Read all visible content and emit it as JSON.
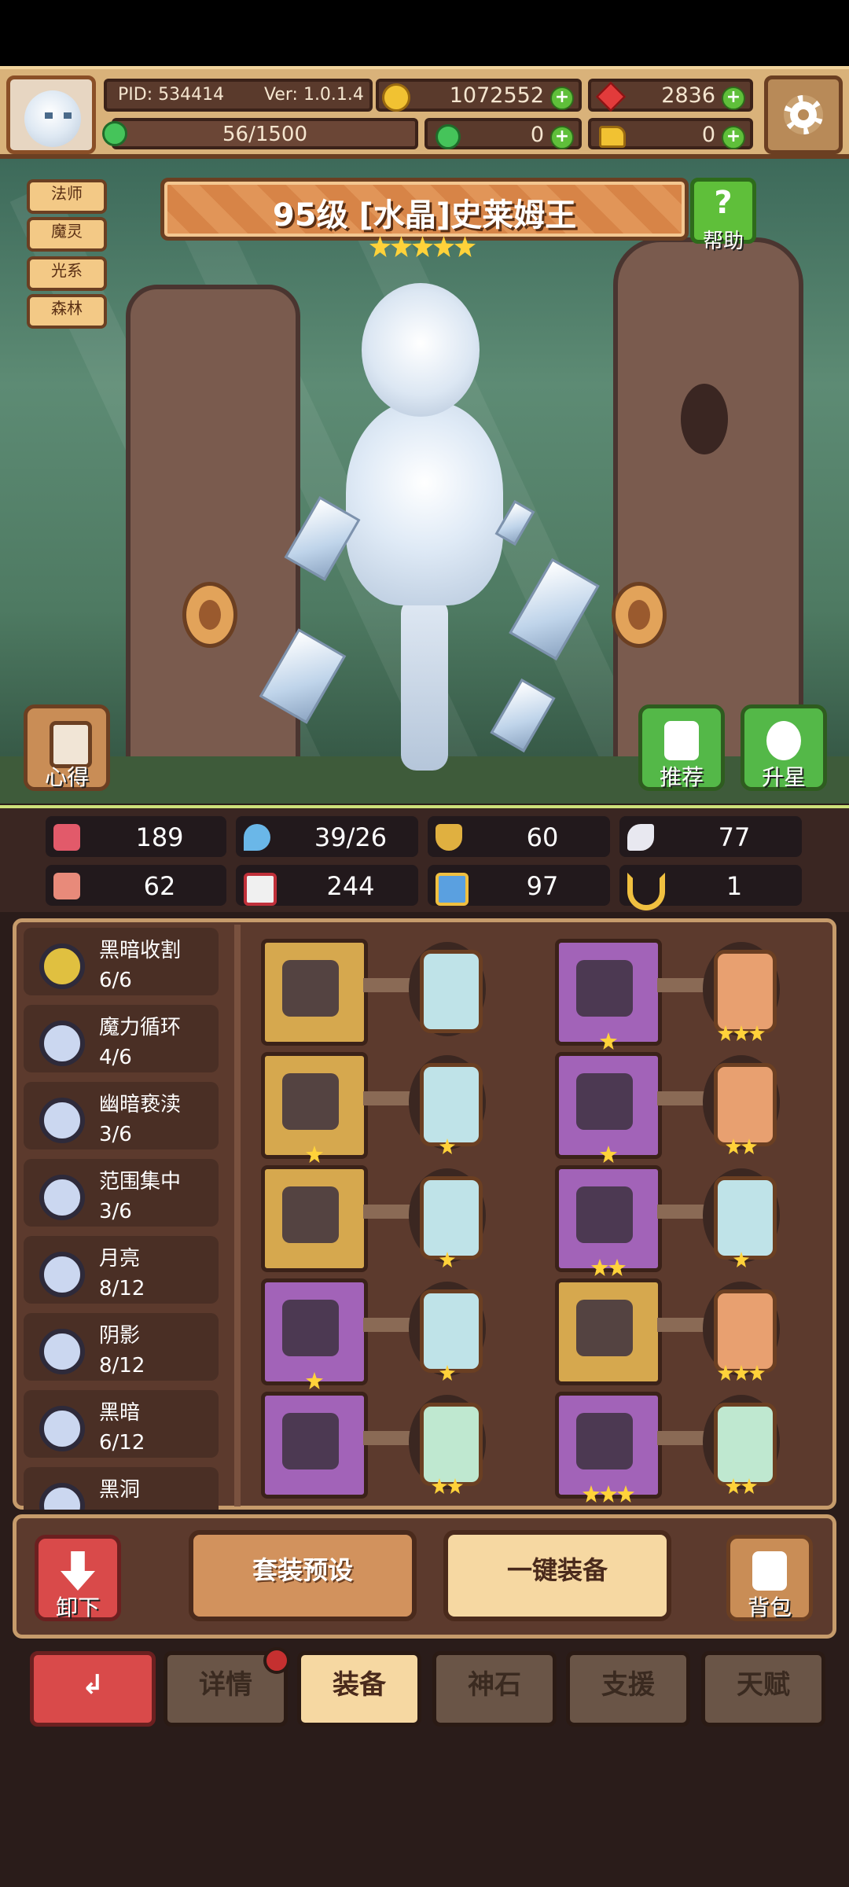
{
  "header": {
    "pid_label": "PID: 534414",
    "version_label": "Ver: 1.0.1.4",
    "gold": "1072552",
    "gems": "2836",
    "xp": "56/1500",
    "clovers": "0",
    "boots": "0"
  },
  "hero": {
    "title": "95级 [水晶]史莱姆王",
    "stars": 5,
    "tags": [
      "法师",
      "魔灵",
      "光系",
      "森林"
    ],
    "help_label": "帮助",
    "insight_label": "心得",
    "recommend_label": "推荐",
    "upgrade_star_label": "升星"
  },
  "stats": {
    "hp": "189",
    "mana": "39/26",
    "defense": "60",
    "speed": "77",
    "attack": "62",
    "magic": "244",
    "crit": "97",
    "luck": "1"
  },
  "skills": [
    {
      "name": "黑暗收割",
      "count": "6/6"
    },
    {
      "name": "魔力循环",
      "count": "4/6"
    },
    {
      "name": "幽暗亵渎",
      "count": "3/6"
    },
    {
      "name": "范围集中",
      "count": "3/6"
    },
    {
      "name": "月亮",
      "count": "8/12"
    },
    {
      "name": "阴影",
      "count": "8/12"
    },
    {
      "name": "黑暗",
      "count": "6/12"
    },
    {
      "name": "黑洞",
      "count": ""
    }
  ],
  "equipment": {
    "left": [
      {
        "icon": "staff-icon",
        "stars": 0,
        "gem_stars": 0
      },
      {
        "icon": "spear-icon",
        "stars": 1,
        "gem_stars": 1
      },
      {
        "icon": "necklace-icon",
        "stars": 0,
        "gem_stars": 1
      },
      {
        "icon": "amulet-icon",
        "stars": 1,
        "gem_stars": 1
      },
      {
        "icon": "ring-icon",
        "stars": 0,
        "gem_stars": 2
      }
    ],
    "right": [
      {
        "icon": "hat-icon",
        "stars": 1,
        "gem_stars": 3
      },
      {
        "icon": "armor-icon",
        "stars": 1,
        "gem_stars": 2
      },
      {
        "icon": "gauntlet-icon",
        "stars": 2,
        "gem_stars": 1
      },
      {
        "icon": "jewel-ring-icon",
        "stars": 0,
        "gem_stars": 3
      },
      {
        "icon": "boots-icon",
        "stars": 3,
        "gem_stars": 2
      }
    ]
  },
  "actions": {
    "unequip_label": "卸下",
    "preset_label": "套装预设",
    "quick_equip_label": "一键装备",
    "bag_label": "背包"
  },
  "tabs": [
    "详情",
    "装备",
    "神石",
    "支援",
    "天赋"
  ],
  "colors": {
    "accent_gold": "#f1c232",
    "plus_green": "#5fbf3a",
    "back_red": "#d94a4a"
  }
}
